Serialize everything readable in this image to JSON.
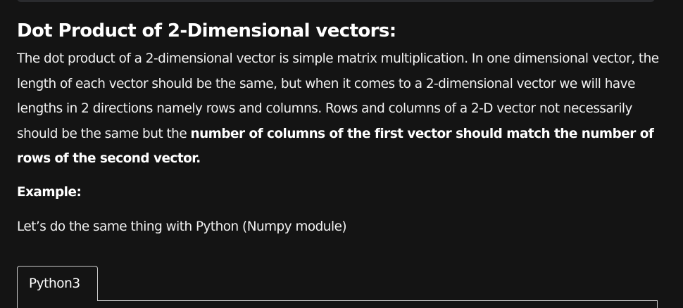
{
  "article": {
    "heading": "Dot Product of 2-Dimensional vectors:",
    "paragraph_plain": "The dot product of a 2-dimensional vector is simple matrix multiplication. In one dimensional vector, the length of each vector should be the same, but when it comes to a 2-dimensional vector we will have lengths in 2 directions namely rows and columns. Rows and columns of a 2-D  vector not necessarily should be the same but the ",
    "paragraph_bold": "number of columns of the first vector should match the number of rows of the second vector.",
    "example_label": "Example:",
    "intro_text": "Let’s do the same thing with Python (Numpy module)"
  },
  "code_block": {
    "tab_label": "Python3"
  }
}
